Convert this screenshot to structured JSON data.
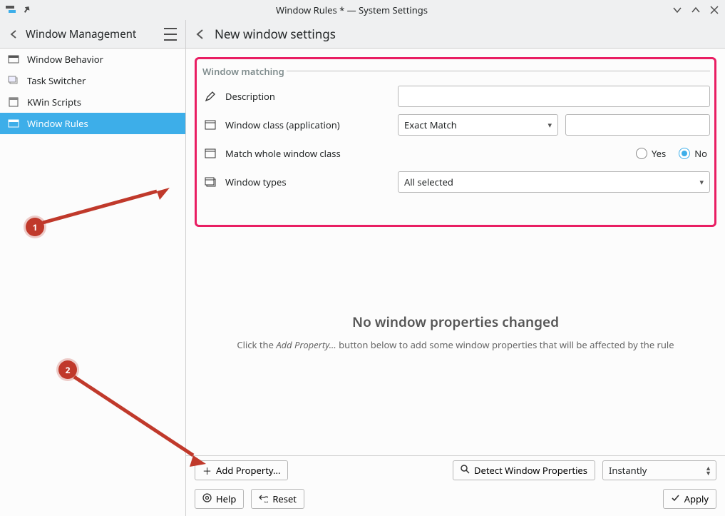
{
  "window": {
    "title": "Window Rules * — System Settings"
  },
  "sidebar": {
    "header": "Window Management",
    "items": [
      {
        "label": "Window Behavior",
        "active": false
      },
      {
        "label": "Task Switcher",
        "active": false
      },
      {
        "label": "KWin Scripts",
        "active": false
      },
      {
        "label": "Window Rules",
        "active": true
      }
    ]
  },
  "page": {
    "title": "New window settings",
    "matching_section": "Window matching",
    "rows": {
      "description_label": "Description",
      "description_value": "",
      "class_label": "Window class (application)",
      "class_match_mode": "Exact Match",
      "class_value": "",
      "whole_class_label": "Match whole window class",
      "whole_class_yes": "Yes",
      "whole_class_no": "No",
      "whole_class_selected": "No",
      "types_label": "Window types",
      "types_value": "All selected"
    },
    "empty": {
      "title": "No window properties changed",
      "prefix": "Click the ",
      "em": "Add Property...",
      "suffix": " button below to add some window properties that will be affected by the rule"
    }
  },
  "bottom": {
    "add_property": "Add Property...",
    "detect": "Detect Window Properties",
    "instantly": "Instantly",
    "help": "Help",
    "reset": "Reset",
    "apply": "Apply"
  },
  "annotations": {
    "callouts": [
      {
        "n": "1"
      },
      {
        "n": "2"
      }
    ]
  }
}
